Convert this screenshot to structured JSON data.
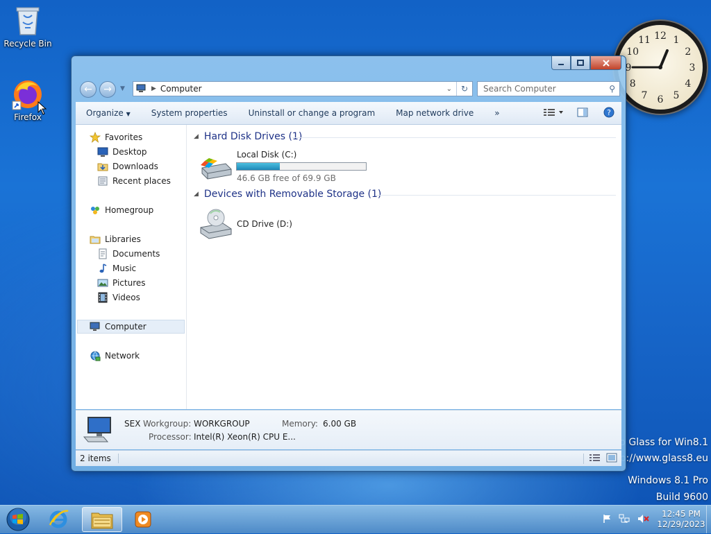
{
  "desktop": {
    "icons": [
      {
        "label": "Recycle Bin",
        "icon": "recycle-bin-icon"
      },
      {
        "label": "Firefox",
        "icon": "firefox-icon"
      }
    ],
    "watermark": {
      "line1": "o Glass for Win8.1",
      "line2": "p://www.glass8.eu",
      "line3": "Windows 8.1 Pro",
      "line4": "Build 9600"
    },
    "clock_gadget": {
      "hours": [
        "12",
        "1",
        "2",
        "3",
        "4",
        "5",
        "6",
        "7",
        "8",
        "9",
        "10",
        "11"
      ],
      "time": "12:45"
    }
  },
  "window": {
    "caption_buttons": {
      "minimize": "minimize-icon",
      "maximize": "maximize-icon",
      "close": "close-icon"
    },
    "address": {
      "current": "Computer",
      "search_placeholder": "Search Computer"
    },
    "toolbar": {
      "organize": "Organize",
      "system_properties": "System properties",
      "uninstall": "Uninstall or change a program",
      "map_drive": "Map network drive",
      "more": "»"
    },
    "nav": {
      "favorites": "Favorites",
      "desktop": "Desktop",
      "downloads": "Downloads",
      "recent": "Recent places",
      "homegroup": "Homegroup",
      "libraries": "Libraries",
      "documents": "Documents",
      "music": "Music",
      "pictures": "Pictures",
      "videos": "Videos",
      "computer": "Computer",
      "network": "Network"
    },
    "groups": {
      "hdd_header": "Hard Disk Drives (1)",
      "removable_header": "Devices with Removable Storage (1)"
    },
    "drives": {
      "c_label": "Local Disk (C:)",
      "c_free": "46.6 GB free of 69.9 GB",
      "c_used_fraction": 0.333,
      "d_label": "CD Drive (D:)"
    },
    "details": {
      "name": "SEX",
      "workgroup_label": "Workgroup:",
      "workgroup_value": "WORKGROUP",
      "memory_label": "Memory:",
      "memory_value": "6.00 GB",
      "processor_label": "Processor:",
      "processor_value": "Intel(R) Xeon(R) CPU E..."
    },
    "status": {
      "items": "2 items"
    }
  },
  "taskbar": {
    "time": "12:45 PM",
    "date": "12/29/2023"
  }
}
